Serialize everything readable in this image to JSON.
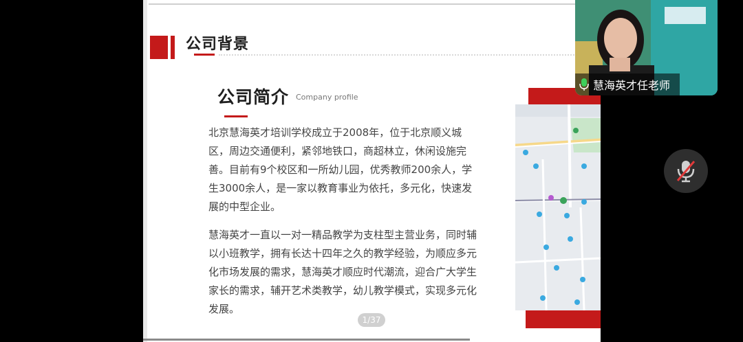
{
  "slide": {
    "section_title": "公司背景",
    "intro_title": "公司简介",
    "intro_subtitle": "Company profile",
    "paragraph1": "北京慧海英才培训学校成立于2008年，位于北京顺义城区，周边交通便利，紧邻地铁口，商超林立，休闲设施完善。目前有9个校区和一所幼儿园，优秀教师200余人，学生3000余人，是一家以教育事业为依托，多元化，快速发展的中型企业。",
    "paragraph2": "慧海英才一直以一对一精品教学为支柱型主营业务，同时辅以小班教学，拥有长达十四年之久的教学经验，为顺应多元化市场发展的需求，慧海英才顺应时代潮流，迎合广大学生家长的需求，辅开艺术类教学，幼儿教学模式，实现多元化发展。",
    "page_indicator": "1/37",
    "map_icon": "map-image"
  },
  "video": {
    "participant_name": "慧海英才任老师",
    "mic_icon": "microphone-icon"
  },
  "controls": {
    "mute_icon": "microphone-muted-icon"
  },
  "colors": {
    "accent_red": "#c41a1a",
    "background": "#000000"
  }
}
